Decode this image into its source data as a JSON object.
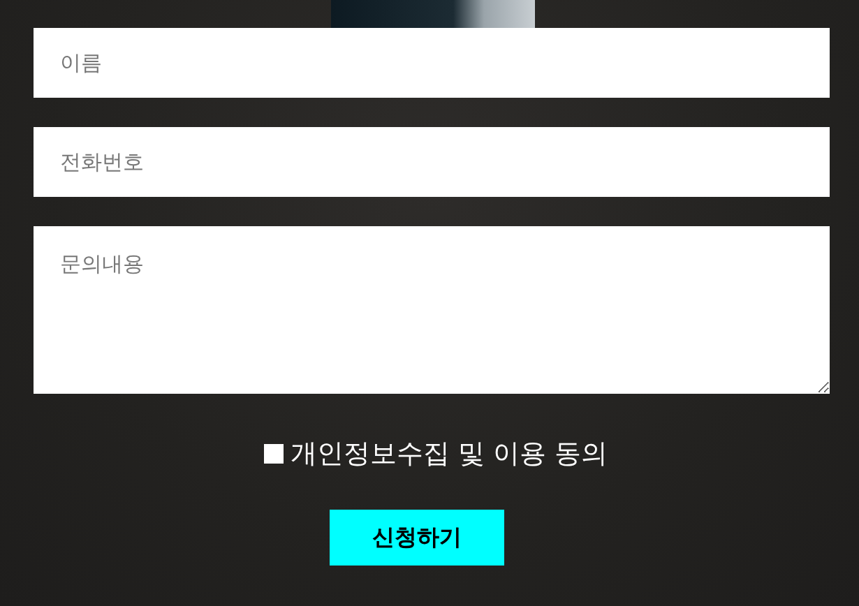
{
  "form": {
    "fields": [
      {
        "kind": "input",
        "placeholder": "이름"
      },
      {
        "kind": "input",
        "placeholder": "전화번호"
      },
      {
        "kind": "textarea",
        "placeholder": "문의내용"
      }
    ],
    "consent": {
      "label": "개인정보수집 및 이용 동의",
      "checked": false
    },
    "submit": "신청하기"
  }
}
